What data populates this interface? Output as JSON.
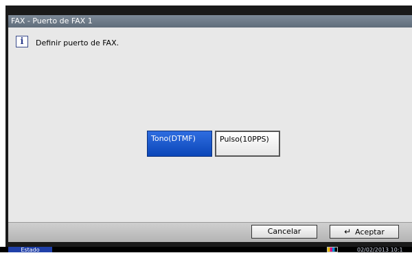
{
  "window": {
    "title": "FAX - Puerto de FAX 1"
  },
  "message": {
    "icon": "info-icon",
    "text": "Definir puerto de FAX."
  },
  "options": [
    {
      "label": "Tono(DTMF)",
      "selected": true
    },
    {
      "label": "Pulso(10PPS)",
      "selected": false
    }
  ],
  "footer": {
    "cancel_label": "Cancelar",
    "accept_label": "Aceptar"
  },
  "status": {
    "label": "Estado",
    "datetime": "02/02/2013 10:1"
  },
  "colors": {
    "selected": "#0b46b8",
    "title_bar": "#6b7786"
  }
}
